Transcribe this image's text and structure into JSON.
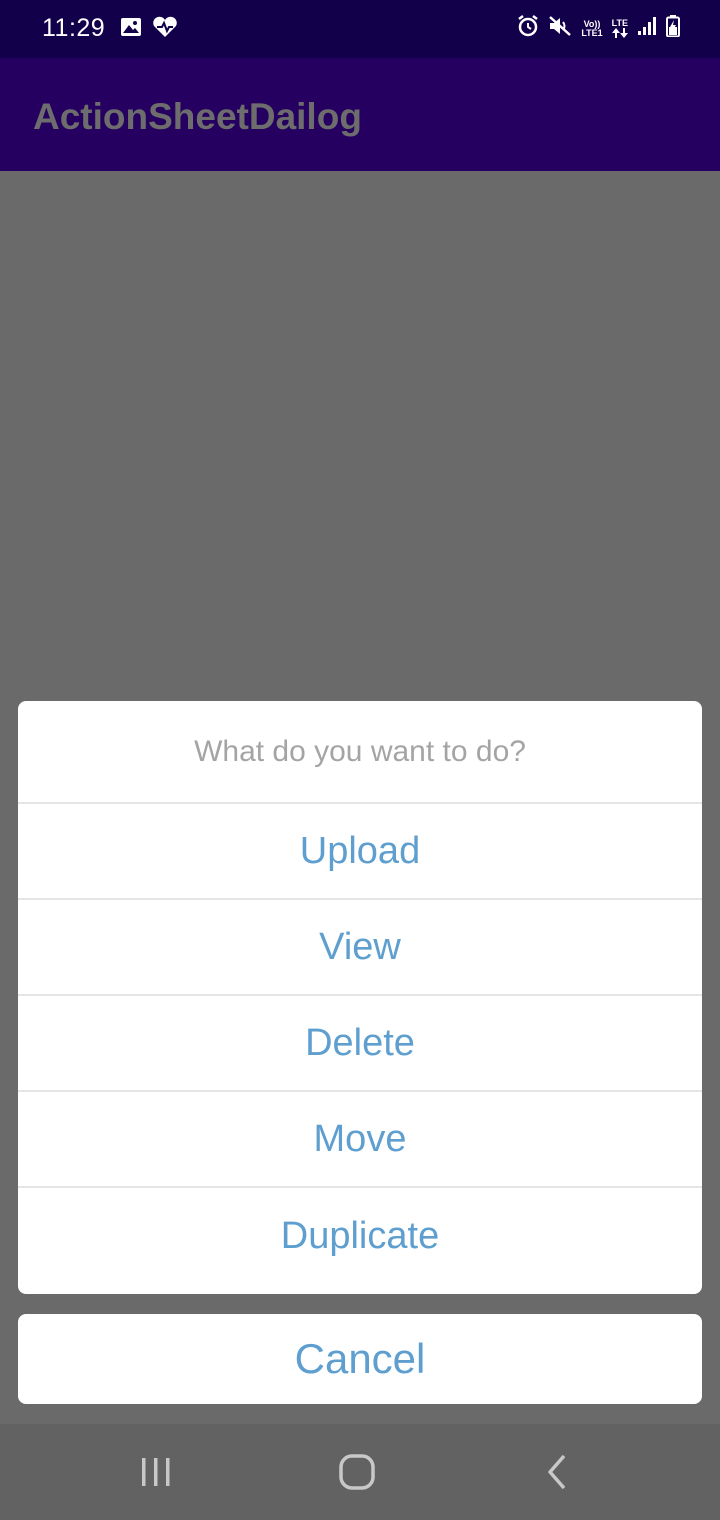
{
  "status_bar": {
    "time": "11:29",
    "left_icons": [
      "gallery-icon",
      "heart-icon"
    ],
    "right_icons": [
      "alarm-icon",
      "mute-icon",
      "volte-icon",
      "lte-data-icon",
      "signal-icon",
      "battery-charging-icon"
    ],
    "volte_text": [
      "Vo))",
      "LTE1"
    ],
    "lte_text": "LTE"
  },
  "app_bar": {
    "title": "ActionSheetDailog"
  },
  "action_sheet": {
    "title": "What do you want to do?",
    "options": [
      "Upload",
      "View",
      "Delete",
      "Move",
      "Duplicate"
    ],
    "cancel_label": "Cancel"
  },
  "nav_bar": {
    "buttons": [
      "recent-apps-icon",
      "home-icon",
      "back-icon"
    ]
  },
  "colors": {
    "status_bar": "#12004a",
    "app_bar": "#260060",
    "scrim": "#6a6a6a",
    "option_text": "#5e9fcf",
    "title_text": "#a4a4a4"
  }
}
